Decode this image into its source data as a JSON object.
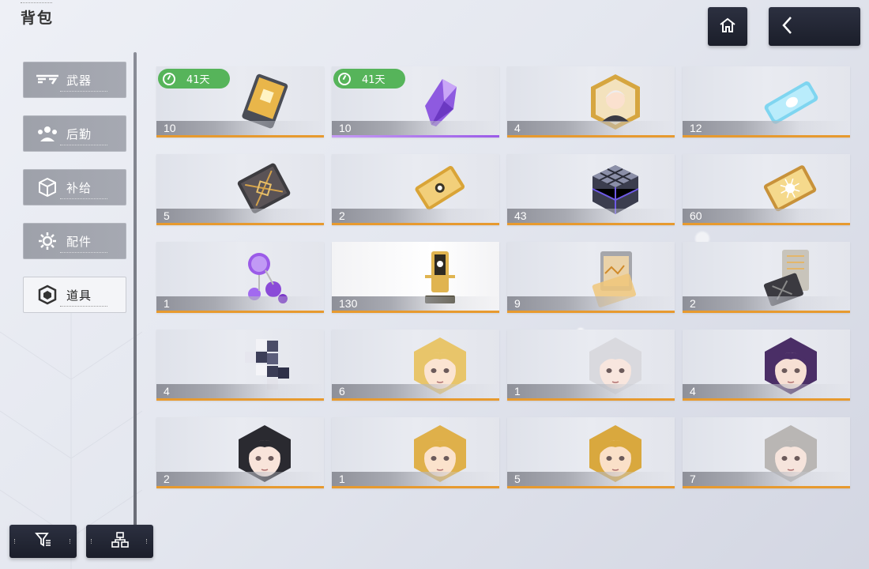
{
  "page": {
    "title": "背包"
  },
  "sidebar": {
    "items": [
      {
        "label": "武器",
        "icon": "weapon-icon",
        "active": false
      },
      {
        "label": "后勤",
        "icon": "logistics-icon",
        "active": false
      },
      {
        "label": "补给",
        "icon": "supply-cube-icon",
        "active": false
      },
      {
        "label": "配件",
        "icon": "parts-gear-icon",
        "active": false
      },
      {
        "label": "道具",
        "icon": "item-cube-icon",
        "active": true
      }
    ]
  },
  "header": {
    "home_icon": "home-icon",
    "back_icon": "back-arrow-icon"
  },
  "footer": {
    "filter_icon": "filter-icon",
    "sort_icon": "sort-hierarchy-icon"
  },
  "colors": {
    "rarity_orange": "#e79a2f",
    "rarity_purple": "#9b5be8",
    "timer_green": "#56b45a",
    "button_dark": "#1f2230"
  },
  "items": [
    {
      "qty": "10",
      "timer": "41天",
      "rarity": "orange",
      "icon": "gold-chip-icon"
    },
    {
      "qty": "10",
      "timer": "41天",
      "rarity": "purple",
      "icon": "purple-crystal-icon"
    },
    {
      "qty": "4",
      "rarity": "orange",
      "icon": "portrait-badge-icon"
    },
    {
      "qty": "12",
      "rarity": "orange",
      "icon": "blue-ticket-icon"
    },
    {
      "qty": "5",
      "rarity": "orange",
      "icon": "dark-card-icon"
    },
    {
      "qty": "2",
      "rarity": "orange",
      "icon": "gold-card-icon"
    },
    {
      "qty": "43",
      "rarity": "orange",
      "icon": "rubik-cube-icon"
    },
    {
      "qty": "60",
      "rarity": "orange",
      "icon": "sun-card-icon"
    },
    {
      "qty": "1",
      "rarity": "orange",
      "icon": "purple-orbs-icon"
    },
    {
      "qty": "130",
      "rarity": "orange",
      "icon": "gold-trophy-icon",
      "highlighted": true
    },
    {
      "qty": "9",
      "rarity": "orange",
      "icon": "glass-card-icon"
    },
    {
      "qty": "2",
      "rarity": "orange",
      "icon": "device-stand-icon"
    },
    {
      "qty": "4",
      "rarity": "orange",
      "icon": "cube-stack-icon"
    },
    {
      "qty": "6",
      "rarity": "orange",
      "icon": "blonde-girl-portrait-icon"
    },
    {
      "qty": "1",
      "rarity": "orange",
      "icon": "silver-hair-portrait-icon"
    },
    {
      "qty": "4",
      "rarity": "orange",
      "icon": "purple-hair-portrait-icon"
    },
    {
      "qty": "2",
      "rarity": "orange",
      "icon": "dark-hair-portrait-icon"
    },
    {
      "qty": "1",
      "rarity": "orange",
      "icon": "blonde-portrait-icon"
    },
    {
      "qty": "5",
      "rarity": "orange",
      "icon": "blonde-portrait-2-icon"
    },
    {
      "qty": "7",
      "rarity": "orange",
      "icon": "gray-hair-portrait-icon"
    }
  ]
}
